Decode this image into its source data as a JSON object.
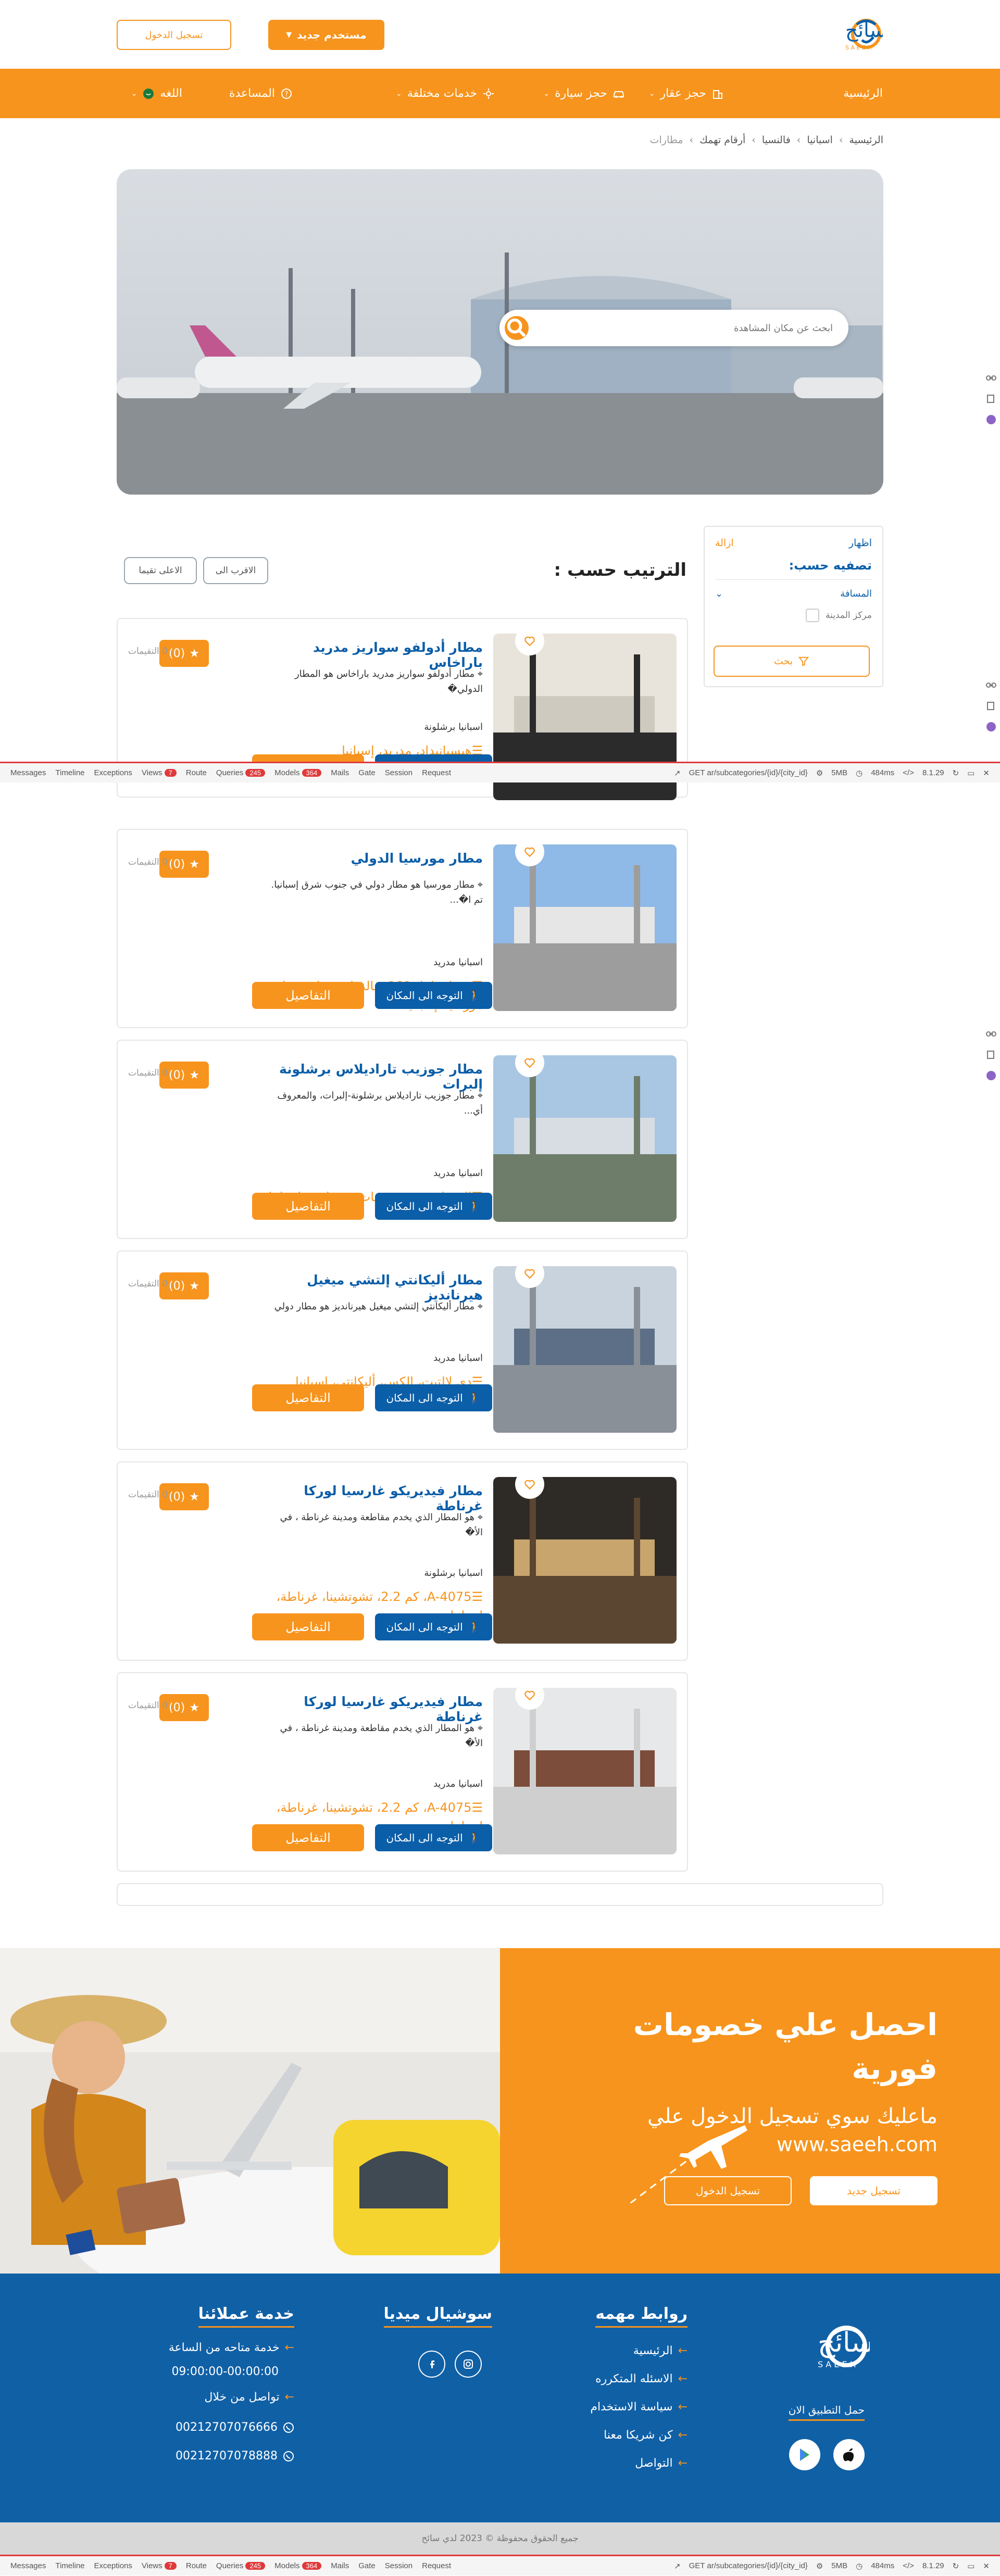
{
  "header": {
    "logo_text": "سائح",
    "logo_sub": "S A E E H",
    "new_user_label": "مستخدم جديد",
    "login_label": "تسجيل الدخول"
  },
  "nav": {
    "home": "الرئيسية",
    "property": "حجز عقار",
    "car": "حجز سيارة",
    "services": "خدمات مختلفة",
    "help": "المساعدة",
    "language": "اللغه"
  },
  "breadcrumb": [
    "الرئيسية",
    "اسبانيا",
    "فالنسيا",
    "أرقام تهمك",
    "مطارات"
  ],
  "hero": {
    "search_placeholder": "ابحث عن مكان المشاهدة"
  },
  "sort": {
    "title": "الترتيب حسب :",
    "nearest": "الاقرب الى",
    "highest_rated": "الاعلى تقيما"
  },
  "filter": {
    "show": "اظهار",
    "remove": "ازالة",
    "heading": "تصفيه حسب:",
    "distance": "المسافة",
    "city_center": "مركز المدينة",
    "search_label": "بحث"
  },
  "card_labels": {
    "go_to_place": "التوجه الى المكان",
    "details": "التفاصيل",
    "reviews": "0 التقيمات",
    "rating": "(0)"
  },
  "listings": [
    {
      "title": "مطار أدولفو سواريز مدريد باراخاس",
      "desc": "مطار أدولفو سواريز مدريد باراخاس هو المطار الدولي�",
      "country": "اسبانيا برشلونة",
      "address": "هيسبانيداد، مدريد، إسبانيا"
    },
    {
      "title": "مطار مورسيا الدولي",
      "desc": "مطار مورسيا هو مطار دولي في جنوب شرق إسبانيا. تم ا�...",
      "country": "اسبانيا مدريد",
      "address": "دي إسبانيا، 101، فالدوليس ولو خورادو، مورسيا، إسبانيا"
    },
    {
      "title": "مطار جوزيب تاراديلاس برشلونة إلبرات",
      "desc": "مطار جوزيب تاراديلاس برشلونة-إلبرات، والمعروف أي...",
      "country": "اسبانيا مدريد",
      "address": "إل برات دي يوبريجات، برشلونة، إسبانيا"
    },
    {
      "title": "مطار أليكانتي إلتشي ميغيل هيرنانديز",
      "desc": "مطار أليكانتي إلتشي ميغيل هيرنانديز هو مطار دولي",
      "country": "اسبانيا مدريد",
      "address": "دي لالتيت، إلكس، أليكانتي، إسبانيا"
    },
    {
      "title": "مطار فيديريكو غارسيا لوركا غرناطة",
      "desc": "هو المطار الذي يخدم مقاطعة ومدينة غرناطة ، في الأ�",
      "country": "اسبانيا برشلونة",
      "address": "A-4075، كم 2.2، تشوتشينا، غرناطة، إسبانيا"
    },
    {
      "title": "مطار فيديريكو غارسيا لوركا غرناطة",
      "desc": "هو المطار الذي يخدم مقاطعة ومدينة غرناطة ، في الأ�",
      "country": "اسبانيا مدريد",
      "address": "A-4075، كم 2.2، تشوتشينا، غرناطة، إسبانيا"
    }
  ],
  "promo": {
    "headline": "احصل علي خصومات فورية",
    "subline": "ماعليك سوي تسجيل الدخول علي",
    "url": "www.saeeh.com",
    "register_label": "تسجيل جديد",
    "login_label": "تسجيل الدخول"
  },
  "footer": {
    "important_links_title": "روابط مهمه",
    "links": [
      "الرئيسية",
      "الاسئله المتكرره",
      "سياسة الاستخدام",
      "كن شريكا معنا",
      "التواصل"
    ],
    "social_title": "سوشيال ميديا",
    "customer_service_title": "خدمة عملائنا",
    "service_hours_label": "خدمة متاحه من الساعة",
    "service_hours": "09:00:00-00:00:00",
    "contact_via": "تواصل من خلال",
    "phone1": "00212707076666",
    "phone2": "00212707078888",
    "download_app": "حمل التطبيق الان",
    "copyright": "جميع الحقوق محفوظة © 2023 لدي سائح"
  },
  "debugbar": {
    "items": [
      "Messages",
      "Timeline",
      "Exceptions",
      "Views",
      "Route",
      "Queries",
      "Models",
      "Mails",
      "Gate",
      "Session",
      "Request"
    ],
    "views_count": "7",
    "queries_count": "245",
    "models_count": "364",
    "request": "GET ar/subcategories/{id}/{city_id}",
    "memory": "5MB",
    "time": "484ms",
    "version": "8.1.29"
  },
  "colors": {
    "orange": "#f7941d",
    "blue": "#0b5ea8",
    "footer_blue": "#1060a6"
  }
}
